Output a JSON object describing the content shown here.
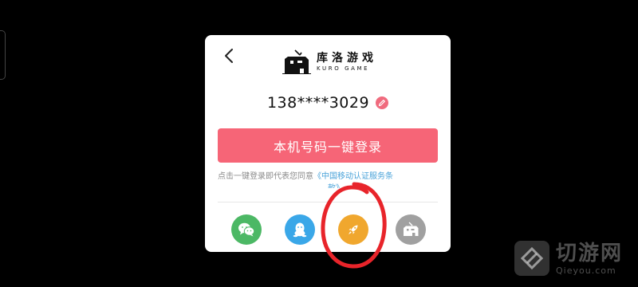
{
  "app": {
    "brand_cn": "库洛游戏",
    "brand_en": "KURO GAME"
  },
  "login": {
    "phone_number": "138****3029",
    "one_click_login_label": "本机号码一键登录",
    "agreement_prefix": "点击一键登录即代表您同意",
    "agreement_link": "《中国移动认证服务条",
    "agreement_link_overflow": "款》"
  },
  "social": {
    "icons": [
      "wechat-icon",
      "qq-icon",
      "rocket-icon",
      "kuro-icon"
    ],
    "colors": [
      "#4cb865",
      "#3aa7e8",
      "#f0a72e",
      "#a0a0a0"
    ]
  },
  "annotation": {
    "color": "#e8242a"
  },
  "watermark": {
    "cn": "切游网",
    "en": "Qieyou.com"
  }
}
